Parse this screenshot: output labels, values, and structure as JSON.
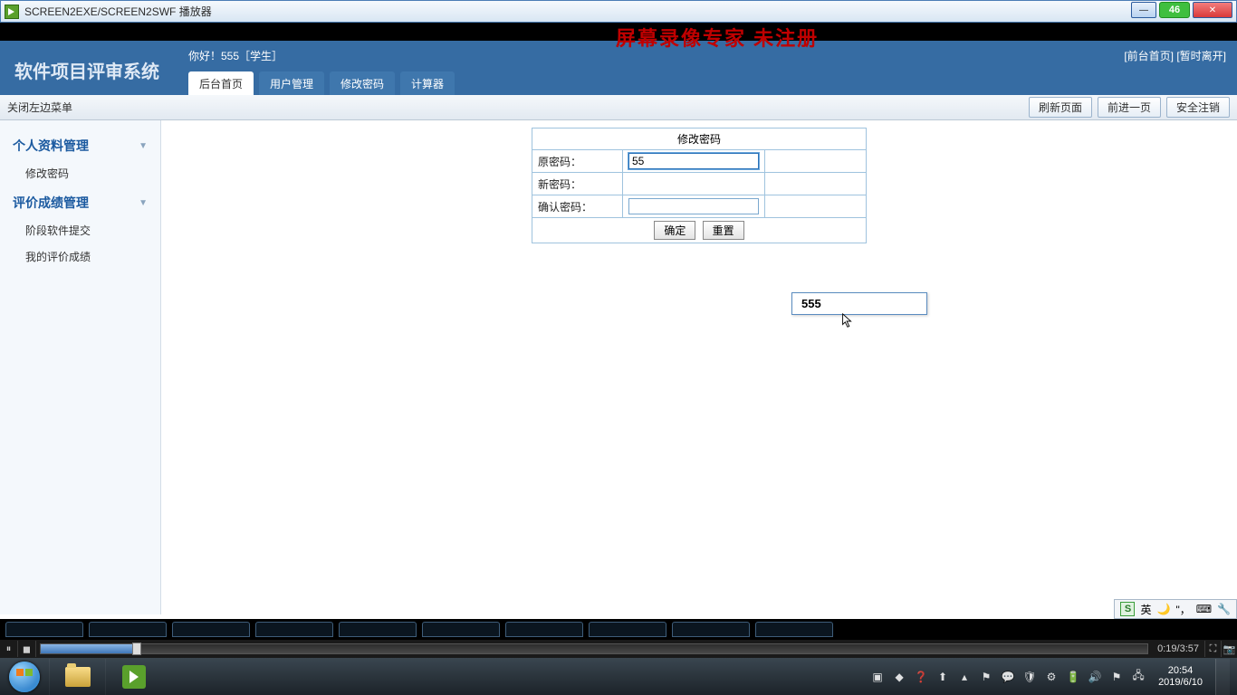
{
  "titlebar": {
    "text": "SCREEN2EXE/SCREEN2SWF 播放器",
    "badge": "46"
  },
  "overlay": "屏幕录像专家  未注册",
  "header": {
    "system_title": "软件项目评审系统",
    "greeting": "你好！555［学生］",
    "links": {
      "front": "[前台首页]",
      "leave": "[暂时离开]"
    },
    "tabs": [
      "后台首页",
      "用户管理",
      "修改密码",
      "计算器"
    ],
    "active_tab_index": 0
  },
  "toolbar": {
    "close_menu": "关闭左边菜单",
    "buttons": [
      "刷新页面",
      "前进一页",
      "安全注销"
    ]
  },
  "sidebar": {
    "groups": [
      {
        "title": "个人资料管理",
        "items": [
          "修改密码"
        ]
      },
      {
        "title": "评价成绩管理",
        "items": [
          "阶段软件提交",
          "我的评价成绩"
        ]
      }
    ]
  },
  "form": {
    "title": "修改密码",
    "rows": [
      {
        "label": "原密码：",
        "value": "55"
      },
      {
        "label": "新密码：",
        "value": ""
      },
      {
        "label": "确认密码：",
        "value": ""
      }
    ],
    "buttons": {
      "ok": "确定",
      "reset": "重置"
    },
    "autocomplete": "555"
  },
  "ime": {
    "lang": "英"
  },
  "playbar": {
    "time": "0:19/3:57"
  },
  "taskbar": {
    "time": "20:54",
    "date": "2019/6/10"
  }
}
